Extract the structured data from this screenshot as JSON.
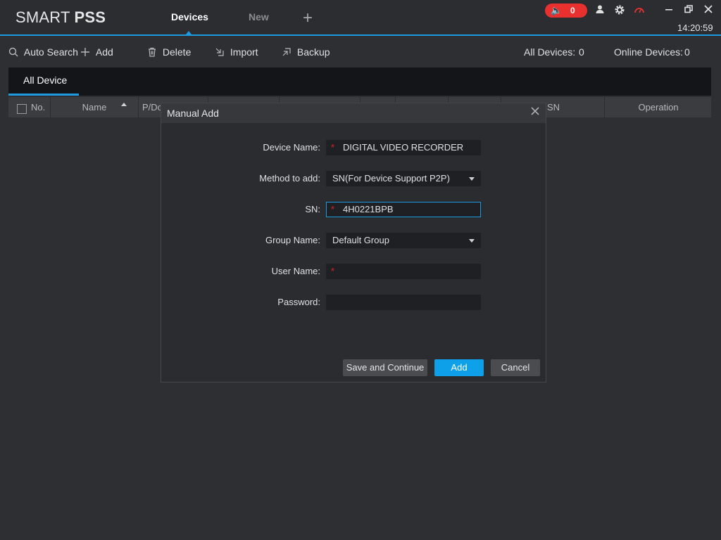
{
  "app": {
    "brand_light": "SMART ",
    "brand_bold": "PSS",
    "tabs": [
      {
        "label": "Devices"
      },
      {
        "label": "New"
      }
    ],
    "add_tab_glyph": "+",
    "alarm_count": "0",
    "clock": "14:20:59",
    "accent_color": "#1e9be0"
  },
  "toolbar": {
    "auto_search": "Auto Search",
    "add": "Add",
    "delete": "Delete",
    "import": "Import",
    "backup": "Backup",
    "all_devices_label": "All Devices:",
    "all_devices_count": "0",
    "online_devices_label": "Online Devices:",
    "online_devices_count": "0"
  },
  "device_tab": "All Device",
  "table": {
    "headers": [
      "No.",
      "Name",
      "P/Do",
      "SN",
      "Operation"
    ]
  },
  "dialog": {
    "title": "Manual Add",
    "fields": [
      {
        "label": "Device Name:",
        "value": "DIGITAL VIDEO RECORDER",
        "required": "*"
      },
      {
        "label": "Method to add:",
        "value": "SN(For Device Support P2P)"
      },
      {
        "label": "SN:",
        "value": "4H0221BPB",
        "required": "*"
      },
      {
        "label": "Group Name:",
        "value": "Default Group"
      },
      {
        "label": "User Name:",
        "value": "",
        "required": "*"
      },
      {
        "label": "Password:",
        "value": ""
      }
    ],
    "buttons": {
      "save_continue": "Save and Continue",
      "add": "Add",
      "cancel": "Cancel"
    }
  }
}
